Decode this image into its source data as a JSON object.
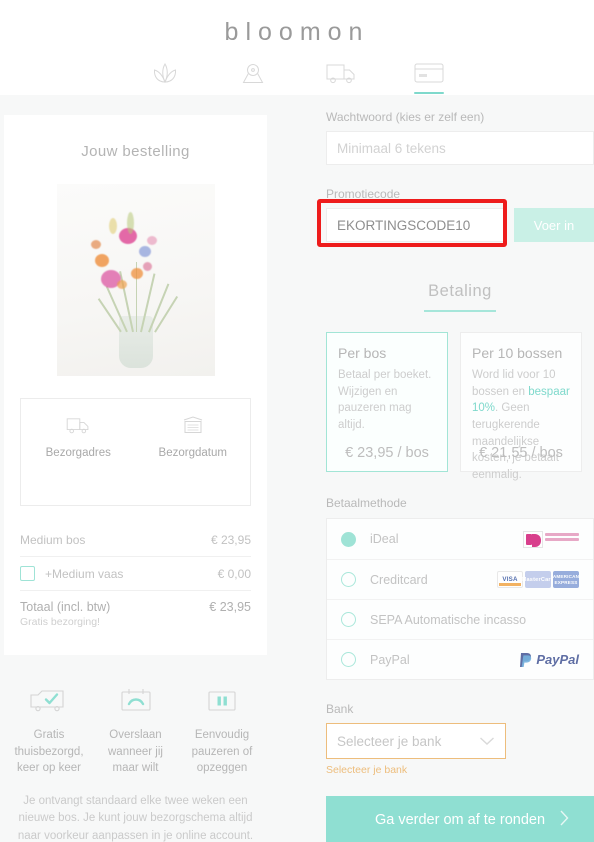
{
  "header": {
    "logo": "bloomon",
    "steps": [
      {
        "name": "flower-icon",
        "active": false
      },
      {
        "name": "location-pin-icon",
        "active": false
      },
      {
        "name": "truck-icon",
        "active": false
      },
      {
        "name": "credit-card-icon",
        "active": true
      }
    ]
  },
  "order": {
    "title": "Jouw bestelling",
    "delivery": [
      {
        "icon": "truck-icon",
        "label": "Bezorgadres"
      },
      {
        "icon": "calendar-icon",
        "label": "Bezorgdatum"
      }
    ],
    "lines": [
      {
        "name": "Medium bos",
        "price": "€ 23,95"
      },
      {
        "name": "+Medium vaas",
        "price": "€ 0,00"
      }
    ],
    "total_label": "Totaal (incl. btw)",
    "total_price": "€ 23,95",
    "total_note": "Gratis bezorging!"
  },
  "benefits": [
    {
      "icon": "truck-check-icon",
      "text": "Gratis thuisbezorgd, keer op keer"
    },
    {
      "icon": "calendar-skip-icon",
      "text": "Overslaan wanneer jij maar wilt"
    },
    {
      "icon": "pause-icon",
      "text": "Eenvoudig pauzeren of opzeggen"
    }
  ],
  "footnote": "Je ontvangt standaard elke twee weken een nieuwe bos. Je kunt jouw bezorgschema altijd naar voorkeur aanpassen in je online account.",
  "form": {
    "password_label": "Wachtwoord (kies er zelf een)",
    "password_placeholder": "Minimaal 6 tekens",
    "password_value": "",
    "promo_label": "Promotiecode",
    "promo_value": "EKORTINGSCODE10",
    "promo_button": "Voer in"
  },
  "payment": {
    "section_title": "Betaling",
    "plans": [
      {
        "title": "Per bos",
        "desc_prefix": "Betaal per boeket. Wijzigen en pauzeren mag altijd.",
        "highlight": "",
        "desc_suffix": "",
        "price": "€ 23,95 / bos",
        "selected": true
      },
      {
        "title": "Per 10 bossen",
        "desc_prefix": "Word lid voor 10 bossen en ",
        "highlight": "bespaar 10%",
        "desc_suffix": ". Geen terugkerende maandelijkse kosten, je betaalt eenmalig.",
        "price": "€ 21,55 / bos",
        "selected": false
      }
    ],
    "method_label": "Betaalmethode",
    "methods": [
      {
        "label": "iDeal",
        "selected": true,
        "logo": "ideal-logo"
      },
      {
        "label": "Creditcard",
        "selected": false,
        "logo": "card-logos"
      },
      {
        "label": "SEPA Automatische incasso",
        "selected": false,
        "logo": "none"
      },
      {
        "label": "PayPal",
        "selected": false,
        "logo": "paypal-logo"
      }
    ],
    "card_logos": [
      "VISA",
      "MasterCard",
      "AMERICAN EXPRESS"
    ],
    "paypal_text": "PayPal",
    "bank_label": "Bank",
    "bank_placeholder": "Selecteer je bank",
    "bank_error": "Selecteer je bank",
    "cta_label": "Ga verder om af te ronden"
  },
  "colors": {
    "accent": "#8fdfd2",
    "accent_light": "#c9f0e6",
    "warning": "#edbd7c",
    "highlight_box": "#ee1c1c",
    "page_bg": "#f7f8f8"
  }
}
